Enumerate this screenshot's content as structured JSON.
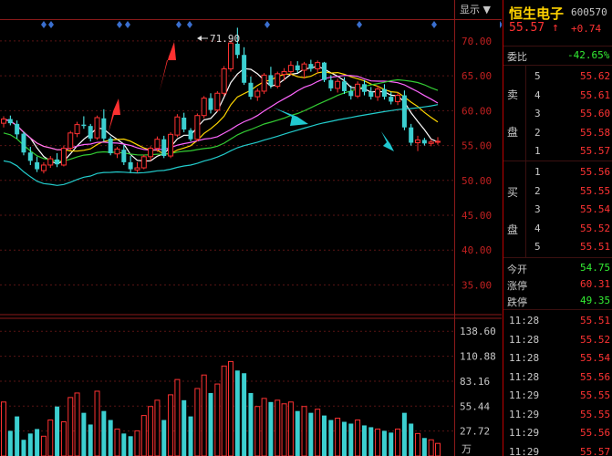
{
  "toolbar": {
    "display_label": "显示 ▼"
  },
  "chart_data": {
    "type": "candlestick",
    "price_axis": {
      "ticks": [
        "70.00",
        "65.00",
        "60.00",
        "55.00",
        "50.00",
        "45.00",
        "40.00",
        "35.00"
      ],
      "ylim": [
        31,
        73
      ]
    },
    "volume_axis": {
      "ticks": [
        "138.60",
        "110.88",
        "83.16",
        "55.44",
        "27.72"
      ],
      "unit": "万",
      "ylim": [
        0,
        150
      ]
    },
    "peak_label": "71.90",
    "candles": [
      [
        58.2,
        59.2,
        57.6,
        58.8
      ],
      [
        58.8,
        59.3,
        57.9,
        58.2
      ],
      [
        58.1,
        58.6,
        56.0,
        56.6
      ],
      [
        56.7,
        57.0,
        53.6,
        54.0
      ],
      [
        54.0,
        54.8,
        52.2,
        52.8
      ],
      [
        52.6,
        53.4,
        51.2,
        51.6
      ],
      [
        51.4,
        52.6,
        51.0,
        52.2
      ],
      [
        52.2,
        53.5,
        51.8,
        53.1
      ],
      [
        53.0,
        53.9,
        51.9,
        52.3
      ],
      [
        52.2,
        55.0,
        52.0,
        54.6
      ],
      [
        54.6,
        57.1,
        54.3,
        56.8
      ],
      [
        56.7,
        58.4,
        56.2,
        58.0
      ],
      [
        58.0,
        59.2,
        57.4,
        57.8
      ],
      [
        57.8,
        58.1,
        55.6,
        56.0
      ],
      [
        56.1,
        59.3,
        55.8,
        59.0
      ],
      [
        58.9,
        60.2,
        55.6,
        56.0
      ],
      [
        56.0,
        56.3,
        53.6,
        53.9
      ],
      [
        53.8,
        54.8,
        53.2,
        54.5
      ],
      [
        54.4,
        55.1,
        52.2,
        52.6
      ],
      [
        52.6,
        53.5,
        51.1,
        51.6
      ],
      [
        51.5,
        52.6,
        51.1,
        51.8
      ],
      [
        51.8,
        53.7,
        51.6,
        53.4
      ],
      [
        53.4,
        54.9,
        52.8,
        54.6
      ],
      [
        54.6,
        56.3,
        54.1,
        55.9
      ],
      [
        55.9,
        56.4,
        53.2,
        53.5
      ],
      [
        53.5,
        56.9,
        53.2,
        56.6
      ],
      [
        56.5,
        59.5,
        56.2,
        59.1
      ],
      [
        59.0,
        59.7,
        56.9,
        57.3
      ],
      [
        57.2,
        57.5,
        55.6,
        55.9
      ],
      [
        55.9,
        59.6,
        55.6,
        59.3
      ],
      [
        59.3,
        62.1,
        58.9,
        61.8
      ],
      [
        61.8,
        62.5,
        59.6,
        60.1
      ],
      [
        60.1,
        62.8,
        59.8,
        62.5
      ],
      [
        62.5,
        66.4,
        62.1,
        66.0
      ],
      [
        66.0,
        70.1,
        65.6,
        69.7
      ],
      [
        69.6,
        71.9,
        67.5,
        68.0
      ],
      [
        68.0,
        69.1,
        63.7,
        64.0
      ],
      [
        64.0,
        64.9,
        61.6,
        62.0
      ],
      [
        62.0,
        63.2,
        61.4,
        62.8
      ],
      [
        62.8,
        65.4,
        62.4,
        65.1
      ],
      [
        65.1,
        66.3,
        63.2,
        63.6
      ],
      [
        63.5,
        65.6,
        63.2,
        65.3
      ],
      [
        65.2,
        66.1,
        64.3,
        65.6
      ],
      [
        65.6,
        67.1,
        65.1,
        66.5
      ],
      [
        66.5,
        67.1,
        65.4,
        65.8
      ],
      [
        65.8,
        67.0,
        64.6,
        66.7
      ],
      [
        66.7,
        67.3,
        65.6,
        66.0
      ],
      [
        66.0,
        67.2,
        65.4,
        66.9
      ],
      [
        66.9,
        67.0,
        64.1,
        64.4
      ],
      [
        64.4,
        65.1,
        62.8,
        63.2
      ],
      [
        63.2,
        64.6,
        62.6,
        64.2
      ],
      [
        64.2,
        64.8,
        62.4,
        62.8
      ],
      [
        62.8,
        63.6,
        61.6,
        62.1
      ],
      [
        62.1,
        64.2,
        61.8,
        63.8
      ],
      [
        63.8,
        64.4,
        62.2,
        62.7
      ],
      [
        62.7,
        63.4,
        61.6,
        62.0
      ],
      [
        62.0,
        63.6,
        61.4,
        63.1
      ],
      [
        63.1,
        63.8,
        61.6,
        62.0
      ],
      [
        62.0,
        62.7,
        60.9,
        61.3
      ],
      [
        61.3,
        62.6,
        60.8,
        62.2
      ],
      [
        62.2,
        62.9,
        57.2,
        57.6
      ],
      [
        57.6,
        58.1,
        55.0,
        55.4
      ],
      [
        55.4,
        56.4,
        54.2,
        55.8
      ],
      [
        55.8,
        56.1,
        55.0,
        55.3
      ],
      [
        55.3,
        55.9,
        54.9,
        55.5
      ],
      [
        55.5,
        56.2,
        55.1,
        55.6
      ]
    ],
    "volumes": [
      60,
      28,
      44,
      18,
      25,
      30,
      22,
      40,
      55,
      38,
      65,
      70,
      48,
      35,
      72,
      50,
      40,
      30,
      25,
      22,
      28,
      45,
      55,
      62,
      40,
      68,
      85,
      62,
      44,
      75,
      90,
      70,
      80,
      100,
      105,
      95,
      92,
      70,
      55,
      64,
      60,
      62,
      58,
      60,
      50,
      55,
      48,
      52,
      45,
      40,
      42,
      38,
      36,
      40,
      34,
      32,
      30,
      28,
      26,
      30,
      48,
      36,
      25,
      20,
      18,
      14
    ],
    "ma_colors": {
      "ma5": "#ffffff",
      "ma10": "#ffd700",
      "ma20": "#ff66ff",
      "ma30": "#33cc33",
      "ma60": "#22cccc"
    }
  },
  "quote": {
    "name": "恒生电子",
    "code": "600570",
    "price": "55.57",
    "arrow": "↑",
    "change": "+0.74",
    "weibi_label": "委比",
    "weibi_value": "-42.65%",
    "sell_label": [
      "卖",
      "盘"
    ],
    "buy_label": [
      "买",
      "盘"
    ],
    "sell": [
      {
        "level": "5",
        "price": "55.62"
      },
      {
        "level": "4",
        "price": "55.61"
      },
      {
        "level": "3",
        "price": "55.60"
      },
      {
        "level": "2",
        "price": "55.58"
      },
      {
        "level": "1",
        "price": "55.57"
      }
    ],
    "buy": [
      {
        "level": "1",
        "price": "55.56"
      },
      {
        "level": "2",
        "price": "55.55"
      },
      {
        "level": "3",
        "price": "55.54"
      },
      {
        "level": "4",
        "price": "55.52"
      },
      {
        "level": "5",
        "price": "55.51"
      }
    ],
    "stats": [
      {
        "label": "今开",
        "value": "54.75",
        "color": "#33ee33"
      },
      {
        "label": "涨停",
        "value": "60.31",
        "color": "#ff3333"
      },
      {
        "label": "跌停",
        "value": "49.35",
        "color": "#33ee33"
      }
    ],
    "ticks": [
      {
        "time": "11:28",
        "price": "55.51"
      },
      {
        "time": "11:28",
        "price": "55.52"
      },
      {
        "time": "11:28",
        "price": "55.54"
      },
      {
        "time": "11:28",
        "price": "55.56"
      },
      {
        "time": "11:29",
        "price": "55.55"
      },
      {
        "time": "11:29",
        "price": "55.55"
      },
      {
        "time": "11:29",
        "price": "55.56"
      },
      {
        "time": "11:29",
        "price": "55.57"
      }
    ]
  }
}
